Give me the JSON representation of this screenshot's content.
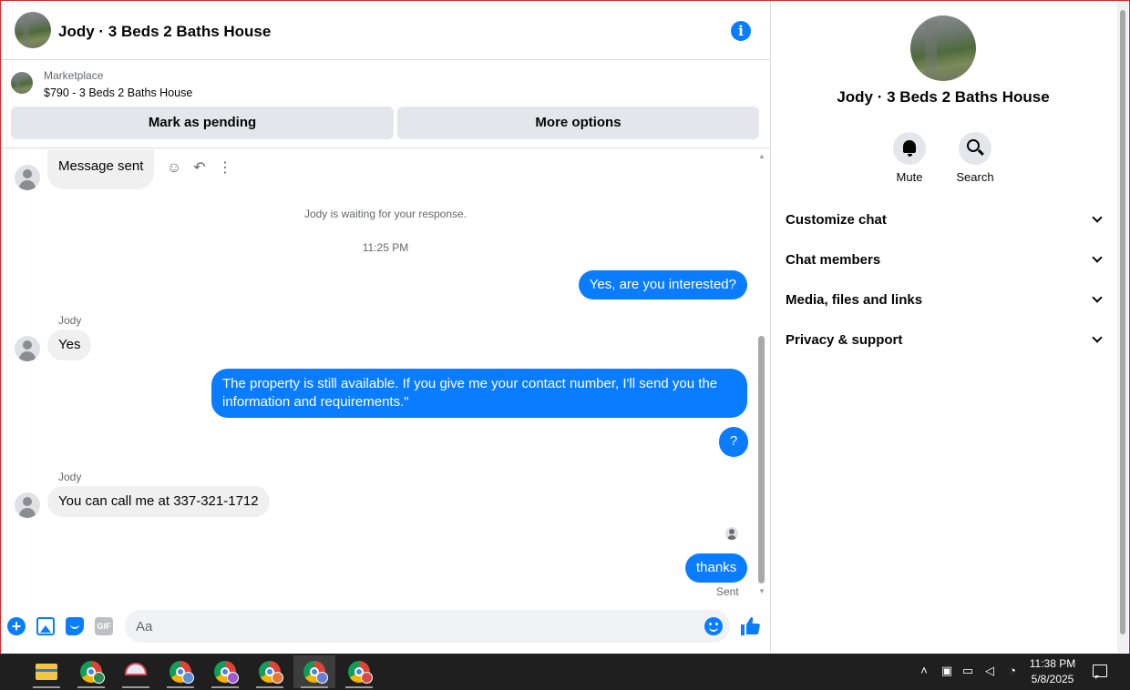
{
  "header": {
    "title": "Jody · 3 Beds 2 Baths House",
    "info_icon": "info-icon"
  },
  "marketplace": {
    "label": "Marketplace",
    "listing": "$790 - 3 Beds 2 Baths House",
    "mark_pending": "Mark as pending",
    "more_options": "More options"
  },
  "messages": {
    "first_in": "Message sent",
    "waiting": "Jody is waiting for your response.",
    "time": "11:25 PM",
    "out1": "Yes, are you interested?",
    "sender1": "Jody",
    "in1": "Yes",
    "out2": "The property is still available. If you give me your contact number, I'll send you the information and requirements.\"",
    "out3": "?",
    "sender2": "Jody",
    "in2": "You can call me at 337-321-1712",
    "out4": "thanks",
    "status": "Sent"
  },
  "composer": {
    "placeholder": "Aa",
    "gif_label": "GIF",
    "plus_label": "+"
  },
  "details": {
    "title": "Jody · 3 Beds 2 Baths House",
    "mute": "Mute",
    "search": "Search",
    "rows": [
      {
        "label": "Customize chat"
      },
      {
        "label": "Chat members"
      },
      {
        "label": "Media, files and links"
      },
      {
        "label": "Privacy & support"
      }
    ]
  },
  "taskbar": {
    "time": "11:38 PM",
    "date": "5/8/2025"
  },
  "colors": {
    "accent": "#0a7cff",
    "incoming_bubble": "#f0f0f0",
    "taskbar": "#1f1f1f"
  }
}
